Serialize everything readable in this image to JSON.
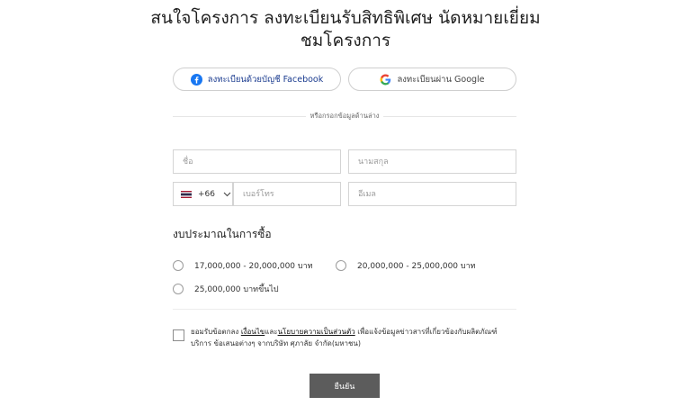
{
  "page": {
    "title_line1": "สนใจโครงการ ลงทะเบียนรับสิทธิพิเศษ นัดหมายเยี่ยม",
    "title_line2": "ชมโครงการ"
  },
  "social": {
    "facebook_label": "ลงทะเบียนด้วยบัญชี Facebook",
    "google_label": "ลงทะเบียนผ่าน Google",
    "or_text": "หรือกรอกข้อมูลด้านล่าง"
  },
  "form": {
    "first_name_placeholder": "ชื่อ",
    "last_name_placeholder": "นามสกุล",
    "country_code": "+66",
    "phone_placeholder": "เบอร์โทร",
    "email_placeholder": "อีเมล"
  },
  "budget": {
    "title": "งบประมาณในการซื้อ",
    "options": [
      "17,000,000 - 20,000,000 บาท",
      "20,000,000 - 25,000,000 บาท",
      "25,000,000 บาทขึ้นไป"
    ]
  },
  "consent": {
    "prefix": "ยอมรับข้อตกลง ",
    "link_terms": "เงื่อนไข",
    "and": "และ",
    "link_privacy": "นโยบายความเป็นส่วนตัว",
    "suffix": " เพื่อแจ้งข้อมูลข่าวสารที่เกี่ยวข้องกับผลิตภัณฑ์ บริการ ข้อเสนอต่างๆ จากบริษัท ศุภาลัย จำกัด(มหาชน)"
  },
  "submit_label": "ยืนยัน",
  "colors": {
    "facebook": "#1877f2",
    "submit_bg": "#5c5c5c",
    "border": "#d4d4d4"
  },
  "icons": [
    "facebook-icon",
    "google-icon",
    "thailand-flag-icon",
    "chevron-down-icon"
  ]
}
